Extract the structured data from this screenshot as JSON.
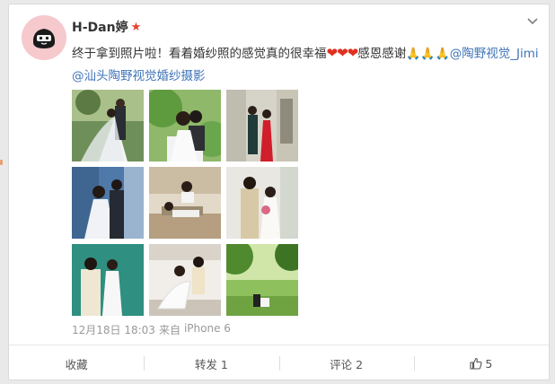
{
  "post": {
    "username": "H-Dan婷",
    "badge_icon": "star-badge-icon",
    "more_icon": "chevron-down-icon",
    "text_1": "终于拿到照片啦！看着婚纱照的感觉真的很幸福",
    "hearts": "❤❤❤",
    "text_2": "感恩感谢",
    "pray": "🙏🙏🙏",
    "mention_1": "@陶野视觉_Jimi",
    "mention_2": "@汕头陶野视觉婚纱摄影",
    "timestamp": "12月18日 18:03",
    "source_prefix": "来自",
    "source": "iPhone 6"
  },
  "photos": [
    {
      "desc": "bride-groom-veil-green-trees"
    },
    {
      "desc": "couple-smiling-leafy-background"
    },
    {
      "desc": "couple-red-dress-building"
    },
    {
      "desc": "couple-standing-trees-blue"
    },
    {
      "desc": "couple-lying-floor-indoor"
    },
    {
      "desc": "couple-beige-suit-bouquet"
    },
    {
      "desc": "couple-teal-background"
    },
    {
      "desc": "couple-sitting-white-indoor"
    },
    {
      "desc": "couple-forest-green"
    }
  ],
  "actions": {
    "favorite": "收藏",
    "repost": "转发 1",
    "comment": "评论 2",
    "like_count": "5"
  },
  "colors": {
    "link": "#3f74b8",
    "heart": "#e0301e",
    "avatar_bg": "#f6c9cc"
  }
}
